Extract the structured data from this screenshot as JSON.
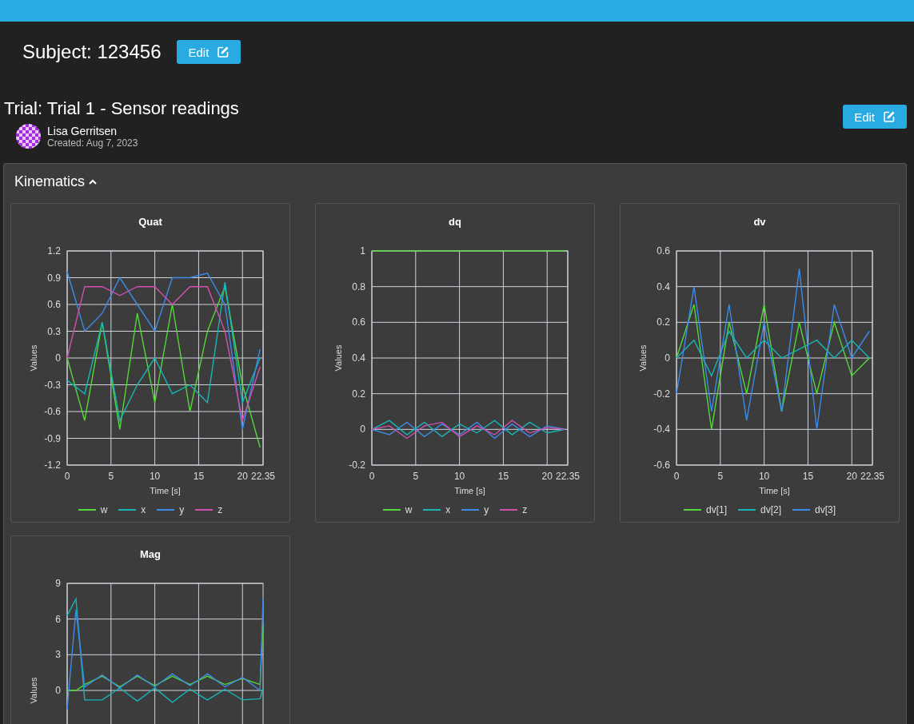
{
  "subject": {
    "title": "Subject: 123456",
    "edit_button": "Edit"
  },
  "trial": {
    "title": "Trial: Trial 1 - Sensor readings",
    "edit_button": "Edit",
    "author": "Lisa Gerritsen",
    "created": "Created: Aug 7, 2023"
  },
  "section": {
    "title": "Kinematics",
    "expanded": true,
    "charts": [
      {
        "chart_data": {
          "type": "line",
          "title": "Quat",
          "xlabel": "Time [s]",
          "ylabel": "Values",
          "x": [
            0,
            2,
            4,
            6,
            8,
            10,
            12,
            14,
            16,
            18,
            20,
            22
          ],
          "xlim": [
            0,
            22.35
          ],
          "ylim": [
            -1.2,
            1.2
          ],
          "xticks": [
            0,
            5,
            10,
            15,
            20,
            22.35
          ],
          "yticks": [
            1.2,
            0.9,
            0.6,
            0.3,
            0,
            -0.3,
            -0.6,
            -0.9,
            -1.2
          ],
          "grid": true,
          "legend": true,
          "series": [
            {
              "name": "w",
              "color": "#55d63c",
              "values": [
                0,
                -0.7,
                0.4,
                -0.8,
                0.5,
                -0.5,
                0.6,
                -0.6,
                0.3,
                0.8,
                -0.3,
                -1.0
              ]
            },
            {
              "name": "x",
              "color": "#17b5b5",
              "values": [
                -0.25,
                -0.4,
                0.4,
                -0.7,
                -0.3,
                0,
                -0.4,
                -0.3,
                -0.5,
                0.85,
                -0.5,
                0
              ]
            },
            {
              "name": "y",
              "color": "#3d8be8",
              "values": [
                0.97,
                0.3,
                0.5,
                0.9,
                0.6,
                0.3,
                0.9,
                0.9,
                0.95,
                0.6,
                -0.8,
                0.1
              ]
            },
            {
              "name": "z",
              "color": "#d050b0",
              "values": [
                0,
                0.8,
                0.8,
                0.7,
                0.8,
                0.8,
                0.6,
                0.8,
                0.8,
                0.3,
                -0.7,
                -0.1
              ]
            }
          ]
        }
      },
      {
        "chart_data": {
          "type": "line",
          "title": "dq",
          "xlabel": "Time [s]",
          "ylabel": "Values",
          "x": [
            0,
            2,
            4,
            6,
            8,
            10,
            12,
            14,
            16,
            18,
            20,
            22
          ],
          "xlim": [
            0,
            22.35
          ],
          "ylim": [
            -0.2,
            1
          ],
          "xticks": [
            0,
            5,
            10,
            15,
            20,
            22.35
          ],
          "yticks": [
            1,
            0.8,
            0.6,
            0.4,
            0.2,
            0,
            -0.2
          ],
          "grid": true,
          "legend": true,
          "series": [
            {
              "name": "w",
              "color": "#55d63c",
              "values": [
                1,
                1,
                1,
                1,
                1,
                1,
                1,
                1,
                1,
                1,
                1,
                1
              ]
            },
            {
              "name": "x",
              "color": "#17b5b5",
              "values": [
                0,
                0.05,
                -0.03,
                0.04,
                -0.04,
                0.03,
                -0.02,
                0.05,
                -0.03,
                0.04,
                -0.02,
                0
              ]
            },
            {
              "name": "y",
              "color": "#3d8be8",
              "values": [
                0,
                -0.03,
                0.04,
                -0.04,
                0.03,
                -0.03,
                0.04,
                -0.05,
                0.03,
                -0.04,
                0.02,
                0
              ]
            },
            {
              "name": "z",
              "color": "#d050b0",
              "values": [
                0,
                0.02,
                -0.05,
                0.02,
                0.04,
                -0.04,
                0.02,
                -0.03,
                0.05,
                -0.02,
                0.01,
                0
              ]
            }
          ]
        }
      },
      {
        "chart_data": {
          "type": "line",
          "title": "dv",
          "xlabel": "Time [s]",
          "ylabel": "Values",
          "x": [
            0,
            2,
            4,
            6,
            8,
            10,
            12,
            14,
            16,
            18,
            20,
            22
          ],
          "xlim": [
            0,
            22.35
          ],
          "ylim": [
            -0.6,
            0.6
          ],
          "xticks": [
            0,
            5,
            10,
            15,
            20,
            22.35
          ],
          "yticks": [
            0.6,
            0.4,
            0.2,
            0,
            -0.2,
            -0.4,
            -0.6
          ],
          "grid": true,
          "legend": true,
          "series": [
            {
              "name": "dv[1]",
              "color": "#55d63c",
              "values": [
                0,
                0.3,
                -0.4,
                0.2,
                -0.2,
                0.3,
                -0.3,
                0.2,
                -0.2,
                0.2,
                -0.1,
                0
              ]
            },
            {
              "name": "dv[2]",
              "color": "#17b5b5",
              "values": [
                0,
                0.1,
                -0.1,
                0.15,
                0,
                0.1,
                0,
                0.05,
                0.1,
                0,
                0.1,
                0
              ]
            },
            {
              "name": "dv[3]",
              "color": "#3d8be8",
              "values": [
                -0.2,
                0.4,
                -0.3,
                0.3,
                -0.35,
                0.2,
                -0.3,
                0.5,
                -0.4,
                0.3,
                0,
                0.15
              ]
            }
          ]
        }
      },
      {
        "chart_data": {
          "type": "line",
          "title": "Mag",
          "ylabel": "Values",
          "x": [
            0,
            1,
            2,
            4,
            6,
            8,
            10,
            12,
            14,
            16,
            18,
            20,
            22,
            22.35
          ],
          "xlim": [
            0,
            22.35
          ],
          "ylim": [
            -9,
            9
          ],
          "yticks": [
            9,
            6,
            3,
            0
          ],
          "grid": true,
          "series": [
            {
              "color": "#55d63c",
              "values": [
                0,
                0,
                0.5,
                1.2,
                0.3,
                1.2,
                0.4,
                1.2,
                0.5,
                1.2,
                0.5,
                1,
                0.5,
                5.5
              ]
            },
            {
              "color": "#17b5b5",
              "values": [
                6.3,
                7.7,
                -0.8,
                -0.8,
                0.2,
                -0.9,
                0.2,
                -1,
                0.1,
                -0.8,
                0.1,
                -0.8,
                -0.7,
                0.2
              ]
            },
            {
              "color": "#3d8be8",
              "values": [
                -1.6,
                6.8,
                0.3,
                1.3,
                0.2,
                1.3,
                0.3,
                1.4,
                0.4,
                1.4,
                0.3,
                1.1,
                0,
                7.8
              ]
            }
          ]
        }
      }
    ]
  }
}
